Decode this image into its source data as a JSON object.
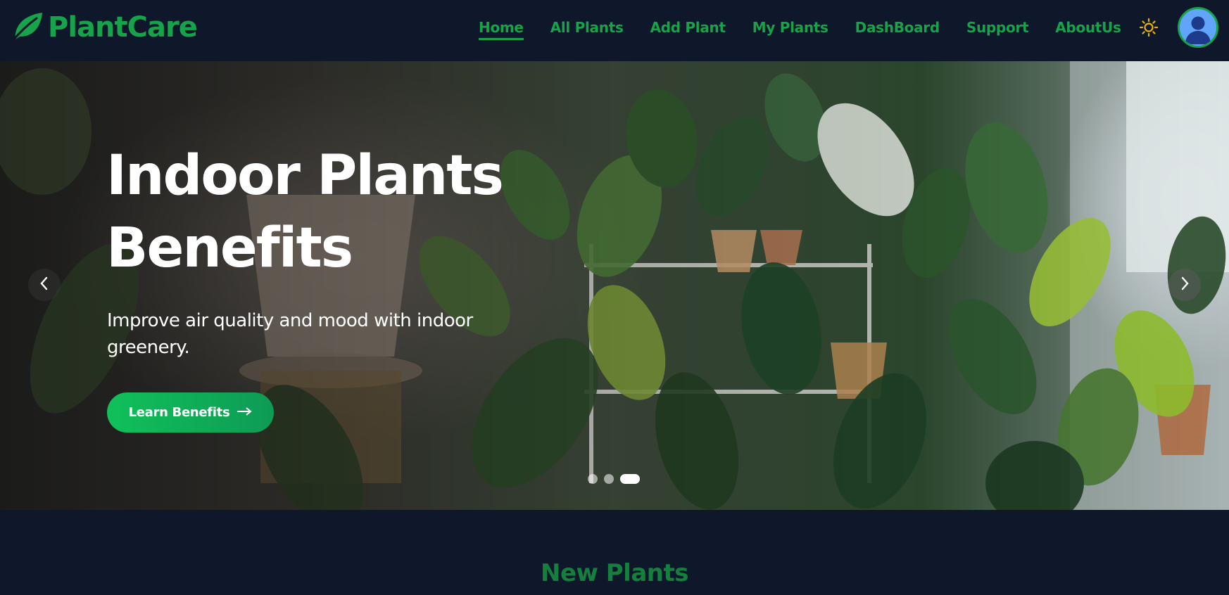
{
  "brand": {
    "name": "PlantCare",
    "icon": "leaf-icon",
    "color": "#16a34a"
  },
  "nav": {
    "items": [
      {
        "label": "Home",
        "active": true
      },
      {
        "label": "All Plants",
        "active": false
      },
      {
        "label": "Add Plant",
        "active": false
      },
      {
        "label": "My Plants",
        "active": false
      },
      {
        "label": "DashBoard",
        "active": false
      },
      {
        "label": "Support",
        "active": false
      },
      {
        "label": "AboutUs",
        "active": false
      }
    ],
    "theme_toggle_icon": "sun-icon",
    "avatar_icon": "user-avatar-icon"
  },
  "hero": {
    "title_line1": "Indoor Plants",
    "title_line2": "Benefits",
    "subtitle": "Improve air quality and mood with indoor greenery.",
    "button_label": "Learn Benefits",
    "button_icon": "arrow-right-icon",
    "prev_icon": "chevron-left-icon",
    "next_icon": "chevron-right-icon",
    "slides_total": 3,
    "active_slide": 3
  },
  "section": {
    "title": "New Plants"
  },
  "colors": {
    "background": "#0f172a",
    "accent": "#16a34a",
    "button": "#10c05a"
  }
}
